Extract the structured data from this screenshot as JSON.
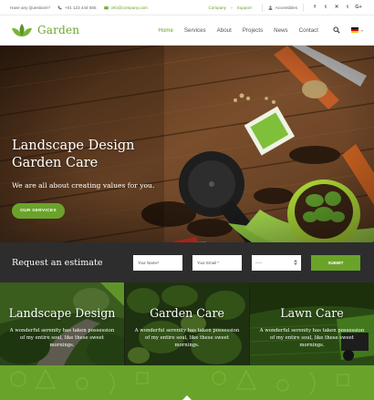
{
  "topbar": {
    "question": "Have any Questions?",
    "phone": "+01 123 444 555",
    "email": "info@company.com",
    "links": [
      "Company",
      "Support"
    ],
    "account": "Accessibles",
    "social": [
      "f",
      "t",
      "✕",
      "t",
      "G+"
    ]
  },
  "header": {
    "logo_text": "Garden",
    "nav": [
      "Home",
      "Services",
      "About",
      "Projects",
      "News",
      "Contact"
    ],
    "active_nav": "Home",
    "language_flag": "de-flag"
  },
  "hero": {
    "title_line1": "Landscape Design",
    "title_line2": "Garden Care",
    "subtitle": "We are all about creating values for you.",
    "button": "OUR SERVICES"
  },
  "estimate": {
    "title": "Request an estimate",
    "name_placeholder": "Your Name*",
    "email_placeholder": "Your Email *",
    "select_value": "-----",
    "submit": "SUBMIT"
  },
  "services": [
    {
      "title": "Landscape Design",
      "text": "A wonderful serenity has taken possession of my entire soul, like these sweet mornings."
    },
    {
      "title": "Garden Care",
      "text": "A wonderful serenity has taken possession of my entire soul, like these sweet mornings."
    },
    {
      "title": "Lawn Care",
      "text": "A wonderful serenity has taken possession of my entire soul, like these sweet mornings."
    }
  ],
  "colors": {
    "accent": "#6aa32a",
    "dark_bar": "#2d2d2d",
    "hero_wood": "#6b4527"
  }
}
